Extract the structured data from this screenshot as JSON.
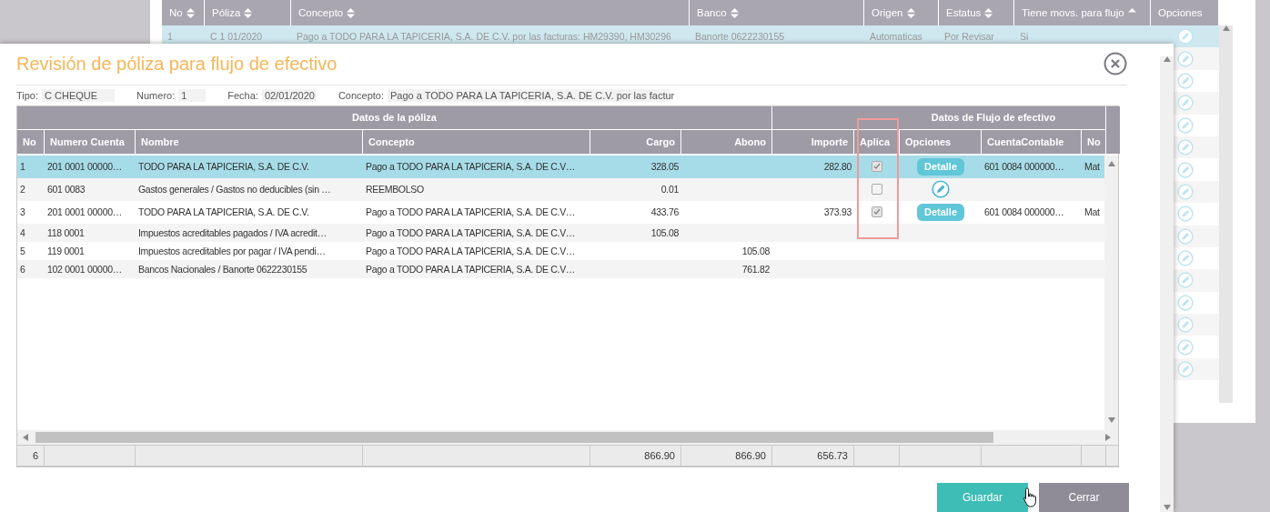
{
  "background_table": {
    "columns": [
      {
        "label": "No",
        "sortable": true,
        "sorted": false
      },
      {
        "label": "Póliza",
        "sortable": true,
        "sorted": false
      },
      {
        "label": "Concepto",
        "sortable": true,
        "sorted": false
      },
      {
        "label": "Banco",
        "sortable": true,
        "sorted": false
      },
      {
        "label": "Origen",
        "sortable": true,
        "sorted": false
      },
      {
        "label": "Estatus",
        "sortable": true,
        "sorted": false
      },
      {
        "label": "Tiene movs. para flujo",
        "sortable": true,
        "sorted": true
      },
      {
        "label": "Opciones",
        "sortable": false
      }
    ],
    "rows": [
      {
        "selected": true,
        "cells": [
          "1",
          "C 1 01/2020",
          "Pago a TODO PARA LA TAPICERIA, S.A. DE C.V. por las facturas: HM29390, HM30296",
          "Banorte 0622230155",
          "Automaticas",
          "Por Revisar",
          "Si"
        ]
      },
      {
        "selected": false
      },
      {
        "selected": false
      },
      {
        "selected": false
      },
      {
        "selected": false
      },
      {
        "selected": false
      },
      {
        "selected": false
      },
      {
        "selected": false
      },
      {
        "selected": false
      },
      {
        "selected": false
      },
      {
        "selected": false
      },
      {
        "selected": false
      },
      {
        "selected": false
      },
      {
        "selected": false
      },
      {
        "selected": false
      },
      {
        "selected": false
      }
    ]
  },
  "dialog": {
    "title": "Revisión de póliza para flujo de efectivo",
    "fields": [
      {
        "label": "Tipo:",
        "value": "C CHEQUE"
      },
      {
        "label": "Numero:",
        "value": "1"
      },
      {
        "label": "Fecha:",
        "value": "02/01/2020"
      },
      {
        "label": "Concepto:",
        "value": "Pago a TODO PARA LA TAPICERIA, S.A. DE C.V. por las factur"
      }
    ],
    "group_headers": [
      "Datos de la póliza",
      "Datos de Flujo de efectivo"
    ],
    "columns": [
      "No",
      "Numero Cuenta",
      "Nombre",
      "Concepto",
      "Cargo",
      "Abono",
      "Importe",
      "Aplica",
      "Opciones",
      "CuentaContable",
      "No"
    ],
    "rows": [
      {
        "selected": true,
        "no": "1",
        "numero_cuenta": "201 0001 00000…",
        "nombre": "TODO PARA LA TAPICERIA, S.A. DE C.V.",
        "concepto": "Pago a TODO PARA LA TAPICERIA, S.A. DE C.V…",
        "cargo": "328.05",
        "abono": "",
        "importe": "282.80",
        "aplica": true,
        "option": {
          "kind": "button",
          "label": "Detalle"
        },
        "cuenta_contable": "601 0084 000000…",
        "column_11": "Mat"
      },
      {
        "selected": false,
        "no": "2",
        "numero_cuenta": "601 0083",
        "nombre": "Gastos generales / Gastos no deducibles (sin …",
        "concepto": "REEMBOLSO",
        "cargo": "0.01",
        "abono": "",
        "importe": "",
        "aplica": false,
        "option": {
          "kind": "edit"
        },
        "cuenta_contable": "",
        "column_11": ""
      },
      {
        "selected": false,
        "no": "3",
        "numero_cuenta": "201 0001 00000…",
        "nombre": "TODO PARA LA TAPICERIA, S.A. DE C.V.",
        "concepto": "Pago a TODO PARA LA TAPICERIA, S.A. DE C.V…",
        "cargo": "433.76",
        "abono": "",
        "importe": "373.93",
        "aplica": true,
        "option": {
          "kind": "button",
          "label": "Detalle"
        },
        "cuenta_contable": "601 0084 000000…",
        "column_11": "Mat"
      },
      {
        "selected": false,
        "no": "4",
        "numero_cuenta": "118 0001",
        "nombre": "Impuestos acreditables pagados / IVA acredit…",
        "concepto": "Pago a TODO PARA LA TAPICERIA, S.A. DE C.V…",
        "cargo": "105.08",
        "abono": "",
        "importe": "",
        "cuenta_contable": "",
        "column_11": ""
      },
      {
        "selected": false,
        "no": "5",
        "numero_cuenta": "119 0001",
        "nombre": "Impuestos acreditables por pagar / IVA pendi…",
        "concepto": "Pago a TODO PARA LA TAPICERIA, S.A. DE C.V…",
        "cargo": "",
        "abono": "105.08",
        "importe": "",
        "cuenta_contable": "",
        "column_11": ""
      },
      {
        "selected": false,
        "no": "6",
        "numero_cuenta": "102 0001 00000…",
        "nombre": "Bancos Nacionales / Banorte 0622230155",
        "concepto": "Pago a TODO PARA LA TAPICERIA, S.A. DE C.V…",
        "cargo": "",
        "abono": "761.82",
        "importe": "",
        "cuenta_contable": "",
        "column_11": ""
      }
    ],
    "footer": {
      "no": "6",
      "cargo": "866.90",
      "abono": "866.90",
      "importe": "656.73"
    },
    "buttons": [
      {
        "label": "Guardar",
        "kind": "primary"
      },
      {
        "label": "Cerrar",
        "kind": "secondary"
      }
    ]
  }
}
